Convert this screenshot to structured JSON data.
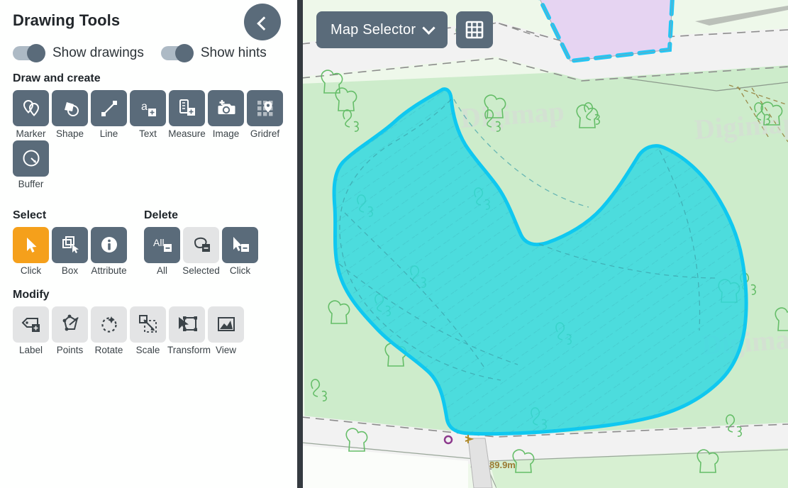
{
  "sidebar": {
    "title": "Drawing Tools",
    "collapse_icon": "chevron-left-icon",
    "toggles": [
      {
        "label": "Show drawings",
        "state": "on"
      },
      {
        "label": "Show hints",
        "state": "on"
      }
    ],
    "sections": [
      {
        "id": "draw-and-create",
        "heading": "Draw and create",
        "tools": [
          {
            "label": "Marker",
            "icon": "marker-pins-icon",
            "state": "enabled"
          },
          {
            "label": "Shape",
            "icon": "shapes-icon",
            "state": "enabled"
          },
          {
            "label": "Line",
            "icon": "line-icon",
            "state": "enabled"
          },
          {
            "label": "Text",
            "icon": "text-add-icon",
            "state": "enabled"
          },
          {
            "label": "Measure",
            "icon": "measure-add-icon",
            "state": "enabled"
          },
          {
            "label": "Image",
            "icon": "camera-add-icon",
            "state": "enabled"
          },
          {
            "label": "Gridref",
            "icon": "gridref-pin-icon",
            "state": "enabled"
          },
          {
            "label": "Buffer",
            "icon": "buffer-circle-icon",
            "state": "enabled"
          }
        ]
      },
      {
        "id": "select",
        "heading": "Select",
        "tools": [
          {
            "label": "Click",
            "icon": "cursor-arrow-icon",
            "state": "active"
          },
          {
            "label": "Box",
            "icon": "box-select-icon",
            "state": "enabled"
          },
          {
            "label": "Attribute",
            "icon": "info-circle-icon",
            "state": "enabled"
          }
        ]
      },
      {
        "id": "delete",
        "heading": "Delete",
        "tools": [
          {
            "label": "All",
            "icon": "delete-all-icon",
            "state": "enabled"
          },
          {
            "label": "Selected",
            "icon": "delete-selected-icon",
            "state": "disabled"
          },
          {
            "label": "Click",
            "icon": "delete-click-icon",
            "state": "enabled"
          }
        ]
      },
      {
        "id": "modify",
        "heading": "Modify",
        "tools": [
          {
            "label": "Label",
            "icon": "label-add-icon",
            "state": "disabled"
          },
          {
            "label": "Points",
            "icon": "points-edit-icon",
            "state": "disabled"
          },
          {
            "label": "Rotate",
            "icon": "rotate-icon",
            "state": "disabled"
          },
          {
            "label": "Scale",
            "icon": "scale-icon",
            "state": "disabled"
          },
          {
            "label": "Transform",
            "icon": "transform-icon",
            "state": "disabled"
          },
          {
            "label": "View",
            "icon": "view-image-icon",
            "state": "disabled"
          }
        ]
      }
    ]
  },
  "map": {
    "selector_label": "Map Selector",
    "selector_chevron": "chevron-down-icon",
    "grid_button_icon": "grid-icon",
    "watermarks": [
      "Digimap",
      "Digimap",
      "Digimap"
    ],
    "labels": [
      {
        "text": "89.9m",
        "kind": "spot-height"
      }
    ],
    "colors": {
      "background": "#eef8ea",
      "woodland_fill": "#cdeccb",
      "road_fill": "#efefef",
      "selected_polygon_fill": "#2fd8e0",
      "selected_polygon_stroke": "#0fc8f0",
      "other_polygon_fill": "#e6d4f2",
      "other_polygon_stroke": "#22c6f5",
      "toolbar_slate": "#5a6b7a",
      "accent_orange": "#f5a01b",
      "panel_edge": "#343a40",
      "spot_height_text": "#9a7a34"
    }
  }
}
